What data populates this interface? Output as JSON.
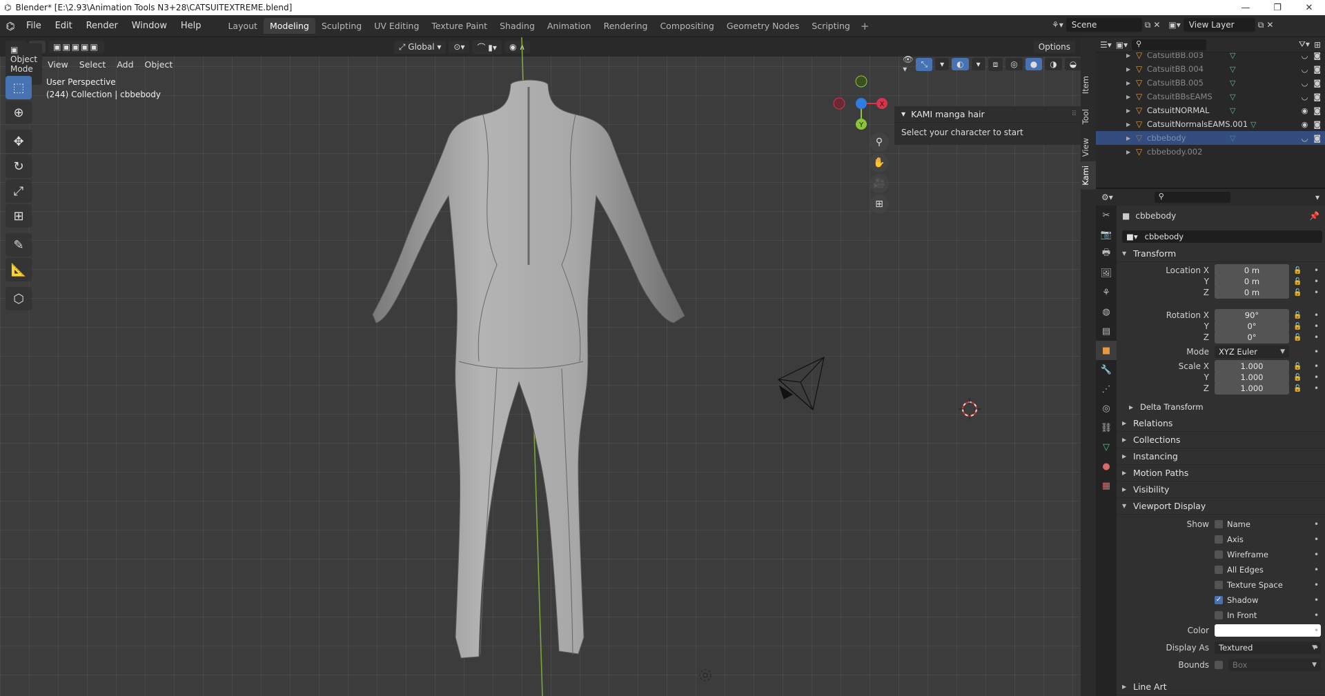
{
  "window": {
    "title": "Blender* [E:\\2.93\\Animation Tools N3+28\\CATSUITEXTREME.blend]",
    "controls": [
      "—",
      "❐",
      "✕"
    ]
  },
  "menu": [
    "File",
    "Edit",
    "Render",
    "Window",
    "Help"
  ],
  "workspaces": [
    {
      "label": "Layout",
      "active": false
    },
    {
      "label": "Modeling",
      "active": true
    },
    {
      "label": "Sculpting",
      "active": false
    },
    {
      "label": "UV Editing",
      "active": false
    },
    {
      "label": "Texture Paint",
      "active": false
    },
    {
      "label": "Shading",
      "active": false
    },
    {
      "label": "Animation",
      "active": false
    },
    {
      "label": "Rendering",
      "active": false
    },
    {
      "label": "Compositing",
      "active": false
    },
    {
      "label": "Geometry Nodes",
      "active": false
    },
    {
      "label": "Scripting",
      "active": false
    }
  ],
  "scene": {
    "name": "Scene",
    "view_layer": "View Layer"
  },
  "viewport": {
    "transform_orientation": "Global",
    "options_label": "Options",
    "mode": "Object Mode",
    "menus": [
      "View",
      "Select",
      "Add",
      "Object"
    ],
    "info_line1": "User Perspective",
    "info_line2": "(244) Collection | cbbebody",
    "side_tabs": [
      "Item",
      "Tool",
      "View",
      "Kami"
    ],
    "active_side_tab": "Kami",
    "gizmo_axes": [
      "X",
      "Y"
    ]
  },
  "kami_panel": {
    "title": "KAMI manga hair",
    "message": "Select your character to start"
  },
  "outliner": {
    "rows": [
      {
        "name": "CatsuitBB.003",
        "selected": false,
        "visible": false
      },
      {
        "name": "CatsuitBB.004",
        "selected": false,
        "visible": false
      },
      {
        "name": "CatsuitBB.005",
        "selected": false,
        "visible": false
      },
      {
        "name": "CatsuitBBsEAMS",
        "selected": false,
        "visible": false
      },
      {
        "name": "CatsuitNORMAL",
        "selected": false,
        "visible": true
      },
      {
        "name": "CatsuitNormalsEAMS.001",
        "selected": false,
        "visible": true
      },
      {
        "name": "cbbebody",
        "selected": true,
        "visible": false
      },
      {
        "name": "cbbebody.002",
        "selected": false,
        "visible": false
      }
    ]
  },
  "properties": {
    "object_name": "cbbebody",
    "data_name": "cbbebody",
    "transform_label": "Transform",
    "location": {
      "label": "Location X",
      "x": "0 m",
      "y": "0 m",
      "z": "0 m"
    },
    "rotation": {
      "label": "Rotation X",
      "x": "90°",
      "y": "0°",
      "z": "0°"
    },
    "mode": {
      "label": "Mode",
      "value": "XYZ Euler"
    },
    "scale": {
      "label": "Scale X",
      "x": "1.000",
      "y": "1.000",
      "z": "1.000"
    },
    "axis_labels": {
      "y": "Y",
      "z": "Z"
    },
    "delta_transform": "Delta Transform",
    "sections": [
      "Relations",
      "Collections",
      "Instancing",
      "Motion Paths",
      "Visibility"
    ],
    "viewport_display": {
      "label": "Viewport Display",
      "show_label": "Show",
      "checks": [
        {
          "label": "Name",
          "on": false
        },
        {
          "label": "Axis",
          "on": false
        },
        {
          "label": "Wireframe",
          "on": false
        },
        {
          "label": "All Edges",
          "on": false
        },
        {
          "label": "Texture Space",
          "on": false
        },
        {
          "label": "Shadow",
          "on": true
        },
        {
          "label": "In Front",
          "on": false
        }
      ],
      "color_label": "Color",
      "color_value": "#ffffff",
      "display_as_label": "Display As",
      "display_as": "Textured",
      "bounds_label": "Bounds",
      "bounds_value": "Box"
    },
    "line_art": "Line Art"
  },
  "colors": {
    "accent": "#4772b3",
    "x_axis": "#d8344a",
    "y_axis": "#8ac43a",
    "z_axis": "#2f7de1",
    "object_orange": "#e69a40",
    "modifier_green": "#55c38b"
  }
}
